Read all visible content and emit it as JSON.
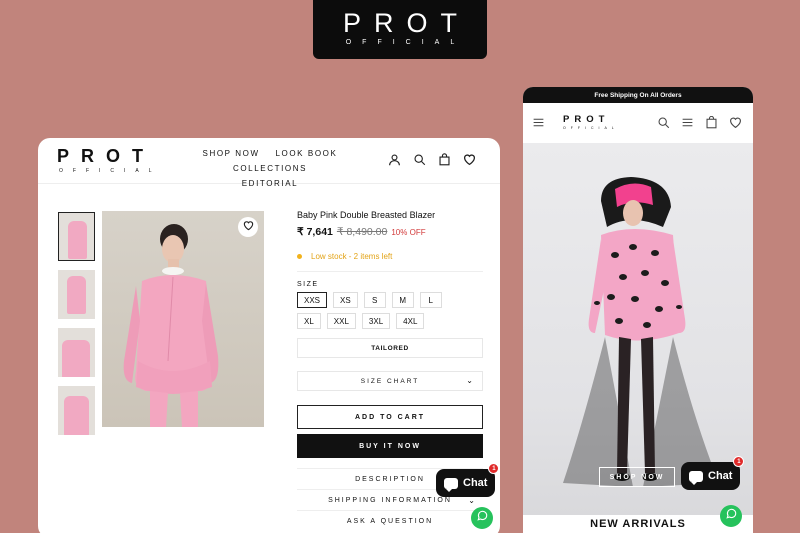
{
  "brand": {
    "name": "PROT",
    "tagline": "OFFICIAL"
  },
  "desktop": {
    "nav": [
      "SHOP NOW",
      "LOOK BOOK",
      "COLLECTIONS",
      "EDITORIAL"
    ],
    "product": {
      "title": "Baby Pink Double Breasted Blazer",
      "price": "₹ 7,641",
      "old_price": "₹ 8,490.00",
      "discount": "10% OFF",
      "stock": "Low stock - 2 items left",
      "size_label": "SIZE",
      "sizes": [
        "XXS",
        "XS",
        "S",
        "M",
        "L",
        "XL",
        "XXL",
        "3XL",
        "4XL"
      ],
      "selected_size": "XXS",
      "fit": "TAILORED",
      "size_chart": "SIZE CHART",
      "add_to_cart": "ADD TO CART",
      "buy_now": "BUY IT NOW",
      "accordions": [
        "DESCRIPTION",
        "SHIPPING INFORMATION",
        "ASK A QUESTION"
      ]
    }
  },
  "chat": {
    "label": "Chat",
    "count": "1"
  },
  "mobile": {
    "announcement": "Free Shipping On All Orders",
    "hero_button": "SHOP NOW",
    "section_title": "NEW ARRIVALS"
  },
  "colors": {
    "background": "#c1847c",
    "accent_pink": "#f1a9c2",
    "stock_yellow": "#e3a418",
    "sale_red": "#d23a3a",
    "whatsapp": "#26c25c"
  }
}
